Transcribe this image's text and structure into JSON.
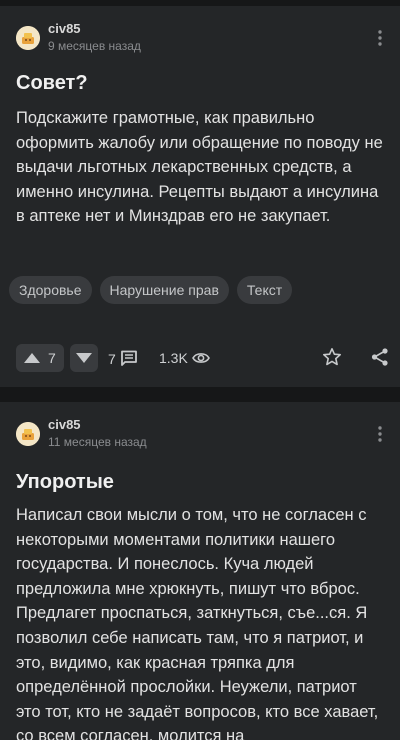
{
  "posts": [
    {
      "author": "civ85",
      "time": "9 месяцев назад",
      "title": "Совет?",
      "body": "Подскажите грамотные, как правильно оформить жалобу или обращение по поводу не выдачи льготных лекарственных средств, а именно инсулина. Рецепты выдают а инсулина в аптеке нет и Минздрав его не закупает.",
      "tags": [
        "Здоровье",
        "Нарушение прав",
        "Текст"
      ],
      "rating": "7",
      "comments": "7",
      "views": "1.3K"
    },
    {
      "author": "civ85",
      "time": "11 месяцев назад",
      "title": "Упоротые",
      "body": "Написал свои мысли о том, что не согласен с некоторыми моментами политики нашего государства. И понеслось. Куча людей предложила мне хрюкнуть, пишут что вброс. Предлагет проспаться, заткнуться, съе...ся. Я позволил себе написать там, что я патриот, и это, видимо, как красная тряпка для определённой прослойки. Неужели, патриот это тот, кто не задаёт вопросов, кто все хавает, со всем согласен, молится на"
    }
  ],
  "icons": {
    "menu": "kebab-menu-icon",
    "upvote": "triangle-up-icon",
    "downvote": "triangle-down-icon",
    "comments": "comment-icon",
    "views": "eye-icon",
    "save": "star-icon",
    "share": "share-icon"
  },
  "colors": {
    "page_bg": "#161718",
    "card_bg": "#242628",
    "chip_bg": "#393b3e",
    "text": "#e6e6e6",
    "muted": "#8a8c8f"
  }
}
